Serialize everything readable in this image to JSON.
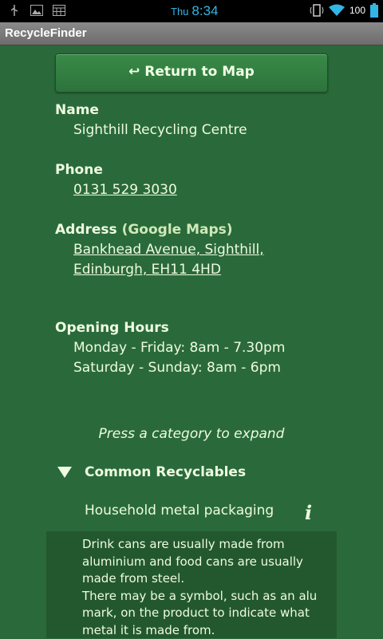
{
  "status_bar": {
    "day": "Thu",
    "time": "8:34",
    "battery": "100",
    "icons": [
      "usb-icon",
      "gallery-icon",
      "calendar-icon",
      "vibrate-icon",
      "wifi-icon",
      "battery-icon"
    ]
  },
  "app": {
    "title": "RecycleFinder"
  },
  "return_button": {
    "label": "↩ Return to Map"
  },
  "details": {
    "name_label": "Name",
    "name_value": "Sighthill Recycling Centre",
    "phone_label": "Phone",
    "phone_value": "0131 529 3030",
    "address_label": "Address",
    "address_maps_link": "(Google Maps)",
    "address_value": "Bankhead Avenue, Sighthill, Edinburgh, EH11 4HD",
    "hours_label": "Opening Hours",
    "hours": [
      "Monday - Friday: 8am - 7.30pm",
      "Saturday - Sunday: 8am - 6pm"
    ]
  },
  "categories": {
    "hint": "Press a category to expand",
    "category_label": "Common Recyclables",
    "item_label": "Household metal packaging",
    "info_label": "i",
    "item_description": "Drink cans are usually made from aluminium and food cans are usually made from steel.\nThere may be a symbol, such as an alu mark, on the product to indicate what metal it is made from."
  },
  "colors": {
    "background": "#2a6a3a",
    "accent": "#33b5e5",
    "text": "#eefbe0"
  }
}
